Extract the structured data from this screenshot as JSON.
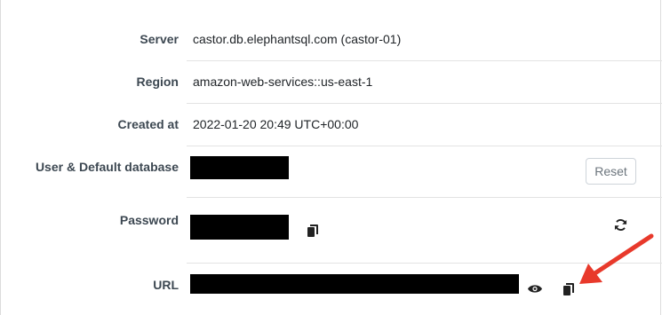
{
  "details": {
    "server": {
      "label": "Server",
      "value": "castor.db.elephantsql.com (castor-01)"
    },
    "region": {
      "label": "Region",
      "value": "amazon-web-services::us-east-1"
    },
    "created": {
      "label": "Created at",
      "value": "2022-01-20 20:49 UTC+00:00"
    },
    "user": {
      "label": "User & Default database",
      "reset_label": "Reset"
    },
    "password": {
      "label": "Password"
    },
    "url": {
      "label": "URL"
    }
  },
  "icons": {
    "copy": "copy-icon",
    "eye": "eye-icon",
    "refresh": "refresh-icon"
  },
  "colors": {
    "annotation_arrow": "#e8392b",
    "redaction": "#000000"
  }
}
